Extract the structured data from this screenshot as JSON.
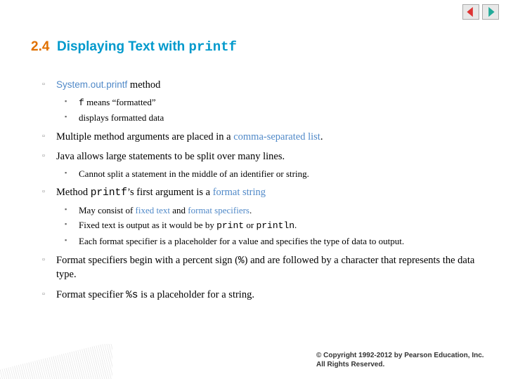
{
  "nav": {
    "prev_color": "#d33",
    "next_color": "#2a9"
  },
  "title": {
    "number": "2.4",
    "text": "Displaying Text with",
    "code": "printf"
  },
  "b1": {
    "term": "System.out.printf",
    "after": " method",
    "s1_code": "f",
    "s1_rest": " means “formatted”",
    "s2": "displays formatted data"
  },
  "b2": {
    "pre": "Multiple method arguments are placed in a ",
    "blue": "comma-separated list",
    "post": "."
  },
  "b3": {
    "text": "Java allows large statements to be split over many lines.",
    "s1": "Cannot split a statement in the middle of an identifier or string."
  },
  "b4": {
    "pre": "Method ",
    "code": "printf",
    "mid": "’s first argument is a ",
    "blue": "format string",
    "s1_pre": "May consist of ",
    "s1_b1": "fixed text",
    "s1_mid": " and ",
    "s1_b2": "format specifiers",
    "s1_post": ".",
    "s2_pre": "Fixed text is output as it would be by ",
    "s2_c1": "print",
    "s2_mid": " or ",
    "s2_c2": "println",
    "s2_post": ".",
    "s3": "Each format specifier is a placeholder for a value and specifies the type of data to output."
  },
  "b5": {
    "pre": "Format specifiers begin with a percent sign (",
    "code": "%",
    "post": ") and are followed by a character that represents the data type."
  },
  "b6": {
    "pre": "Format specifier ",
    "code": "%s",
    "post": " is a placeholder for a string."
  },
  "copyright": "© Copyright 1992-2012 by Pearson Education, Inc. All Rights Reserved."
}
